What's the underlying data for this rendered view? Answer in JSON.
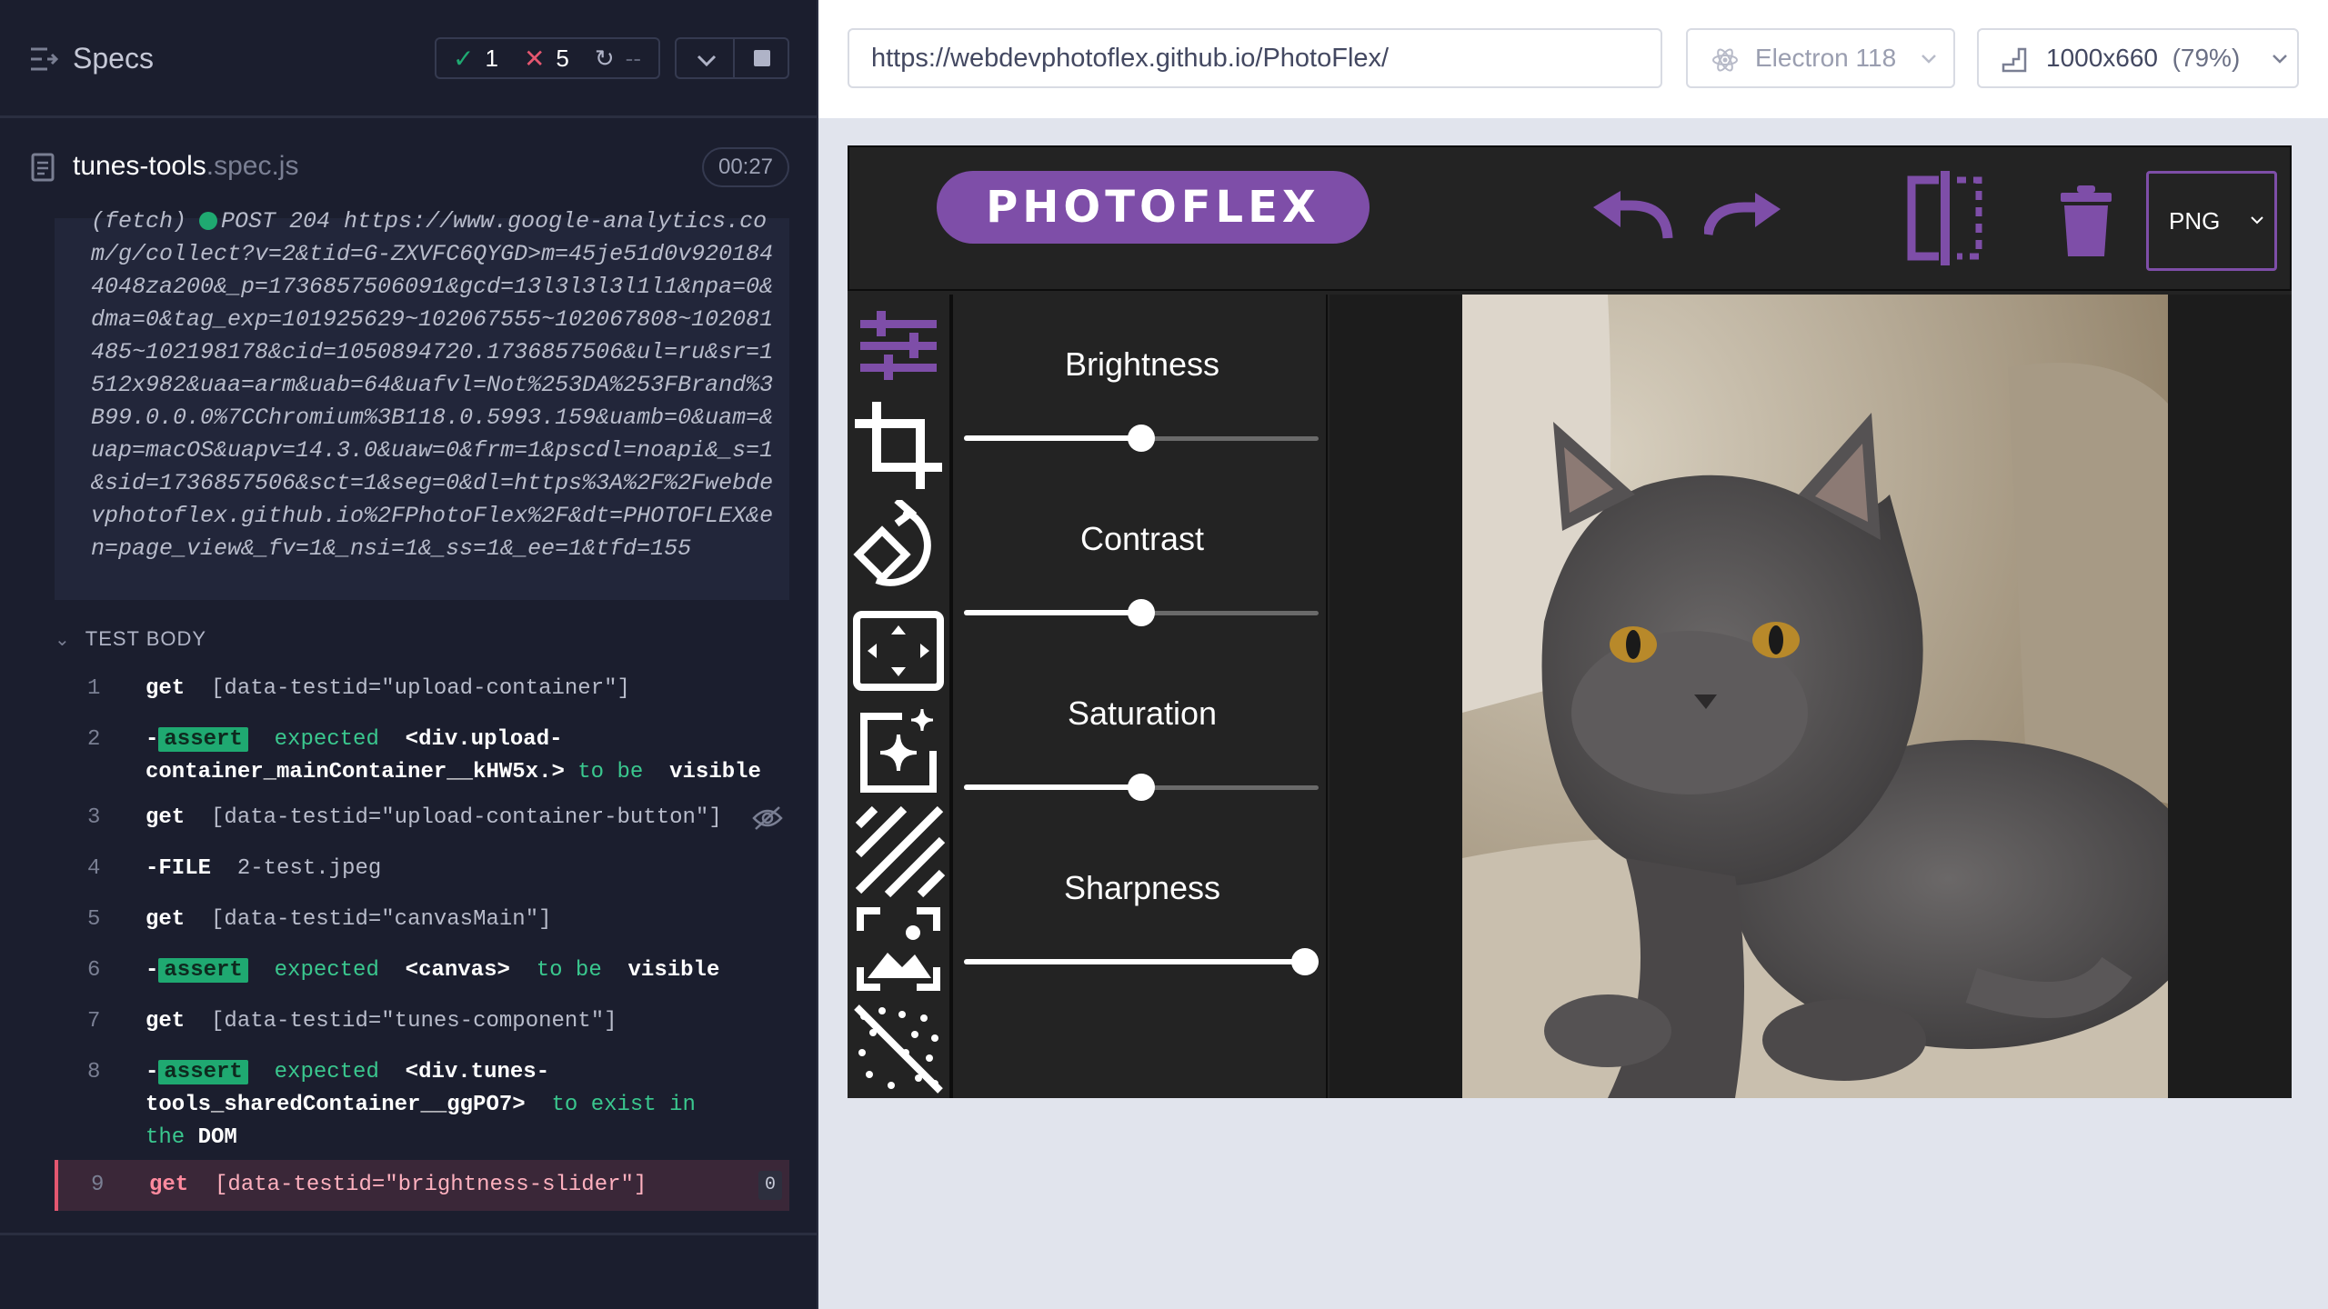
{
  "reporter": {
    "header": {
      "title": "Specs",
      "passed": "1",
      "failed": "5",
      "pending": "--"
    },
    "spec": {
      "name": "tunes-tools",
      "ext": ".spec.js",
      "duration": "00:27"
    },
    "log": {
      "lines": "(fetch)",
      "status": "POST 204 https://www.google-analytics.com/g/collect?v=2&tid=G-ZXVFC6QYGD>m=45je51d0v9201844048za200&_p=1736857506091&gcd=13l3l3l3l1l1&npa=0&dma=0&tag_exp=101925629~102067555~102067808~102081485~102198178&cid=1050894720.1736857506&ul=ru&sr=1512x982&uaa=arm&uab=64&uafvl=Not%253DA%253FBrand%3B99.0.0.0%7CChromium%3B118.0.5993.159&uamb=0&uam=&uap=macOS&uapv=14.3.0&uaw=0&frm=1&pscdl=noapi&_s=1&sid=1736857506&sct=1&seg=0&dl=https%3A%2F%2Fwebdevphotoflex.github.io%2FPhotoFlex%2F&dt=PHOTOFLEX&en=page_view&_fv=1&_nsi=1&_ss=1&_ee=1&tfd=155"
    },
    "test_body_label": "TEST BODY",
    "commands": [
      {
        "no": "1",
        "name": "get",
        "selector": "[data-testid=\"upload-container\"]"
      },
      {
        "no": "2",
        "prefix": "-",
        "badge": "assert",
        "expected": "expected",
        "subject": "<div.upload-container_mainContainer__kHW5x.>",
        "to": "to be",
        "result": "visible"
      },
      {
        "no": "3",
        "name": "get",
        "selector": "[data-testid=\"upload-container-button\"]"
      },
      {
        "no": "4",
        "name": "-FILE",
        "selector": "2-test.jpeg"
      },
      {
        "no": "5",
        "name": "get",
        "selector": "[data-testid=\"canvasMain\"]"
      },
      {
        "no": "6",
        "prefix": "-",
        "badge": "assert",
        "expected": "expected",
        "subject": "<canvas>",
        "to": "to be",
        "result": "visible"
      },
      {
        "no": "7",
        "name": "get",
        "selector": "[data-testid=\"tunes-component\"]"
      },
      {
        "no": "8",
        "prefix": "-",
        "badge": "assert",
        "expected": "expected",
        "subject": "<div.tunes-tools_sharedContainer__ggPO7>",
        "to": "to exist in the",
        "result": "DOM"
      },
      {
        "no": "9",
        "name": "get",
        "selector": "[data-testid=\"brightness-slider\"]",
        "count": "0"
      }
    ]
  },
  "browser": {
    "url": "https://webdevphotoflex.github.io/PhotoFlex/",
    "engine": "Electron 118",
    "viewport": "1000x660",
    "scale": "(79%)"
  },
  "app": {
    "logo": "PHOTOFLEX",
    "format": "PNG",
    "accent": "#7e4ea8",
    "tools": [
      "tunes-icon",
      "crop-icon",
      "rotate-icon",
      "resize-icon",
      "filters-icon",
      "texture-icon",
      "image-frame-icon",
      "noise-icon"
    ],
    "tunes": [
      {
        "label": "Brightness",
        "value": 0.5
      },
      {
        "label": "Contrast",
        "value": 0.5
      },
      {
        "label": "Saturation",
        "value": 0.5
      },
      {
        "label": "Sharpness",
        "value": 1.0
      }
    ]
  }
}
